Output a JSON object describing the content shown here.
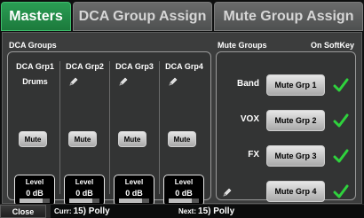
{
  "tabs": [
    {
      "label": "Masters",
      "active": true
    },
    {
      "label": "DCA Group Assign",
      "active": false
    },
    {
      "label": "Mute Group Assign",
      "active": false
    }
  ],
  "dca": {
    "title": "DCA Groups",
    "groups": [
      {
        "name": "DCA Grp1",
        "label": "Drums",
        "editable": false,
        "mute": "Mute",
        "level_title": "Level",
        "level_value": "0 dB",
        "level_fraction": 0.75
      },
      {
        "name": "DCA Grp2",
        "label": "",
        "editable": true,
        "mute": "Mute",
        "level_title": "Level",
        "level_value": "0 dB",
        "level_fraction": 0.75
      },
      {
        "name": "DCA Grp3",
        "label": "",
        "editable": true,
        "mute": "Mute",
        "level_title": "Level",
        "level_value": "0 dB",
        "level_fraction": 0.75
      },
      {
        "name": "DCA Grp4",
        "label": "",
        "editable": true,
        "mute": "Mute",
        "level_title": "Level",
        "level_value": "0 dB",
        "level_fraction": 0.75
      }
    ]
  },
  "mute": {
    "title": "Mute Groups",
    "softkey_title": "On SoftKey",
    "groups": [
      {
        "label": "Band",
        "editable": false,
        "button": "Mute Grp 1",
        "on_softkey": true
      },
      {
        "label": "VOX",
        "editable": false,
        "button": "Mute Grp 2",
        "on_softkey": true
      },
      {
        "label": "FX",
        "editable": false,
        "button": "Mute Grp 3",
        "on_softkey": true
      },
      {
        "label": "",
        "editable": true,
        "button": "Mute Grp 4",
        "on_softkey": true
      }
    ]
  },
  "bottom": {
    "close_label": "Close",
    "current_prefix": "Curr:",
    "current_value": "15) Polly",
    "next_prefix": "Next:",
    "next_value": "15) Polly"
  },
  "colors": {
    "active_tab": "#1c7a3c",
    "check": "#2fd23d"
  },
  "icons": {
    "edit": "pencil-icon",
    "check": "checkmark-icon"
  }
}
